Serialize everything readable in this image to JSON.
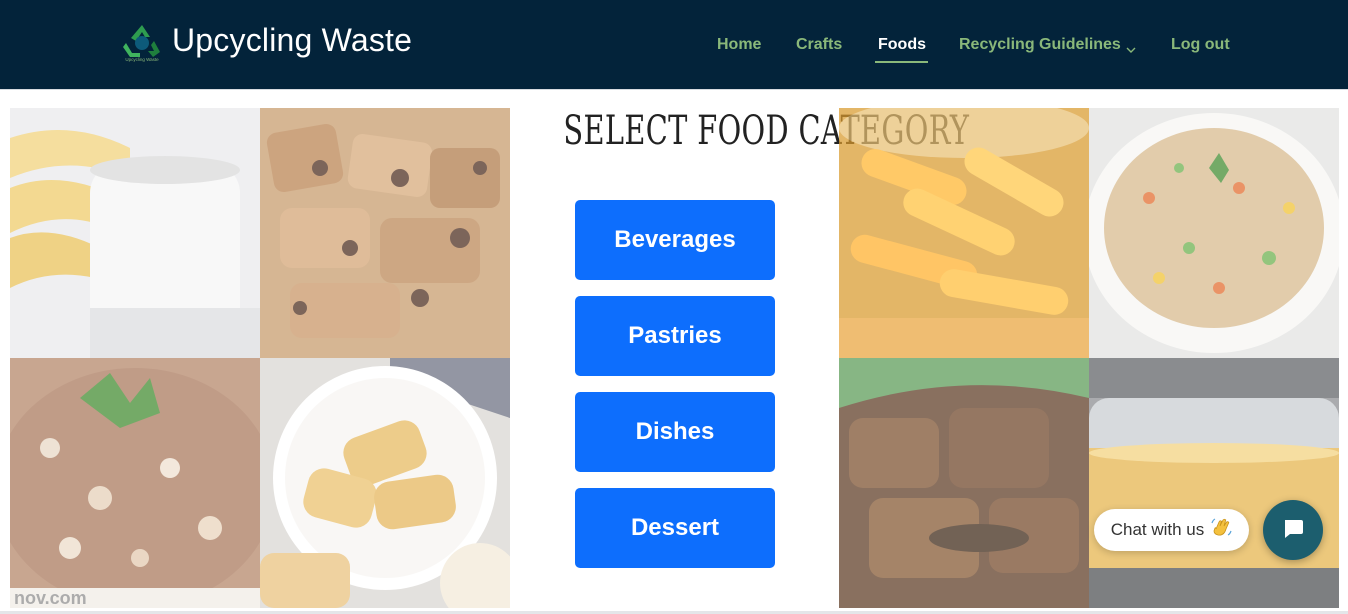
{
  "brand": {
    "name": "Upcycling Waste",
    "logo_caption": "Upcycling Waste"
  },
  "nav": {
    "items": [
      "Home",
      "Crafts",
      "Foods",
      "Recycling Guidelines",
      "Log out"
    ],
    "active": "Foods"
  },
  "icons": {
    "dropdown": "chevron-down-icon",
    "chat": "chat-bubble-icon",
    "wave": "waving-hand-icon",
    "logo": "recycle-icon"
  },
  "main": {
    "title": "SELECT FOOD CATEGORY",
    "categories": [
      "Beverages",
      "Pastries",
      "Dishes",
      "Dessert"
    ]
  },
  "images": {
    "left": [
      "banana-and-coffee-mug",
      "chocolate-bread-pudding",
      "fried-rice-with-parsley",
      "toasted-bread-slices"
    ],
    "right": [
      "pickled-fruit-jar",
      "vegetable-fried-rice",
      "braised-meat-stew",
      "boiling-soup-pot"
    ],
    "watermarks": [
      "nov.com"
    ]
  },
  "chat": {
    "label": "Chat with us"
  },
  "colors": {
    "navbar": "#03233a",
    "nav_link": "#8ab87a",
    "button": "#0d6efd",
    "chat_button": "#1c5e6e"
  }
}
